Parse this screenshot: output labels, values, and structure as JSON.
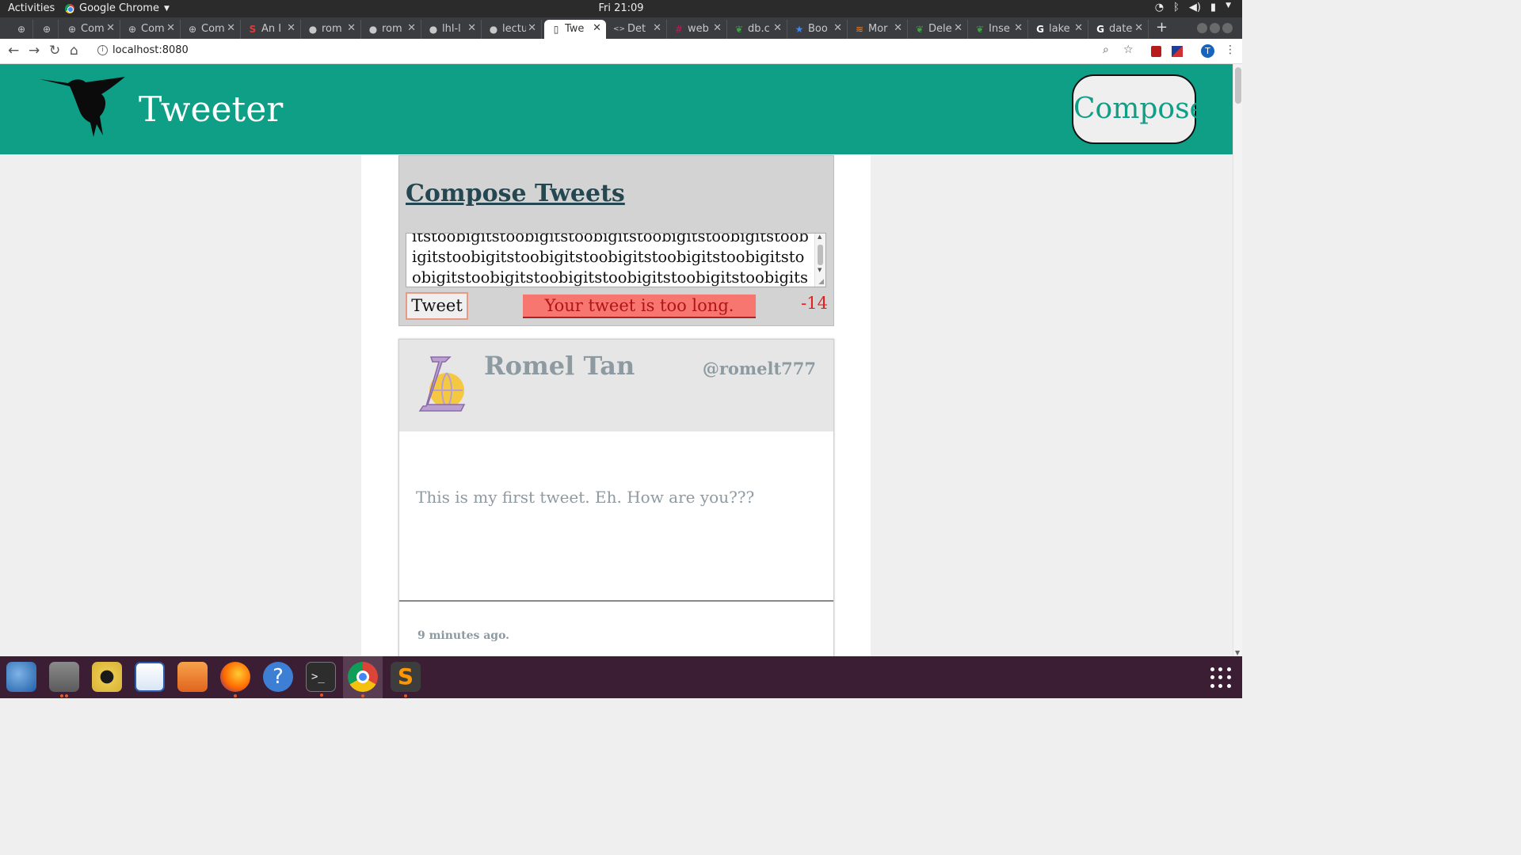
{
  "system_bar": {
    "activities": "Activities",
    "app_name": "Google Chrome",
    "clock": "Fri 21:09"
  },
  "tabs": [
    {
      "title": "",
      "icon": "page-icon"
    },
    {
      "title": "",
      "icon": "page-icon"
    },
    {
      "title": "Com",
      "icon": "page-icon"
    },
    {
      "title": "Com",
      "icon": "page-icon"
    },
    {
      "title": "Com",
      "icon": "page-icon"
    },
    {
      "title": "An I",
      "icon": "s-logo-icon"
    },
    {
      "title": "rom",
      "icon": "github-icon"
    },
    {
      "title": "rom",
      "icon": "github-icon"
    },
    {
      "title": "lhl-l",
      "icon": "github-icon"
    },
    {
      "title": "lectu",
      "icon": "github-icon"
    },
    {
      "title": "Twe",
      "icon": "document-icon",
      "active": true
    },
    {
      "title": "Det",
      "icon": "code-icon"
    },
    {
      "title": "web",
      "icon": "slack-icon"
    },
    {
      "title": "db.c",
      "icon": "leaf-icon"
    },
    {
      "title": "Boo",
      "icon": "star-icon"
    },
    {
      "title": "Mor",
      "icon": "flame-icon"
    },
    {
      "title": "Dele",
      "icon": "leaf-icon"
    },
    {
      "title": "Inse",
      "icon": "leaf-icon"
    },
    {
      "title": "lake",
      "icon": "google-icon"
    },
    {
      "title": "date",
      "icon": "google-icon"
    }
  ],
  "omnibox": {
    "url": "localhost:8080",
    "avatar_letter": "T"
  },
  "page": {
    "brand": "Tweeter",
    "compose_button": "Compose",
    "compose_heading": "Compose Tweets",
    "textarea_value": "itstoobigitstoobigitstoobigitstoobigitstoobigitstoobigitstoobigitstoobigitstoobigitstoobigitstoobigitstoobigitstoobigitstoobigitstoobigitstoobigitstoobigitstoobig",
    "tweet_button": "Tweet",
    "error_message": "Your tweet is too long.",
    "counter": "-14",
    "tweet": {
      "name": "Romel Tan",
      "handle": "@romelt777",
      "body": "This is my first tweet. Eh. How are you???",
      "timestamp": "9 minutes ago."
    }
  },
  "colors": {
    "nav_bg": "#0f9e86",
    "error_bg": "#f7766f",
    "counter": "#e41e1e",
    "tweet_text": "#8d9aa1"
  },
  "dock": [
    "thunderbird-icon",
    "files-icon",
    "rhythmbox-icon",
    "writer-icon",
    "software-icon",
    "firefox-icon",
    "help-icon",
    "terminal-icon",
    "chrome-icon",
    "sublime-icon"
  ]
}
